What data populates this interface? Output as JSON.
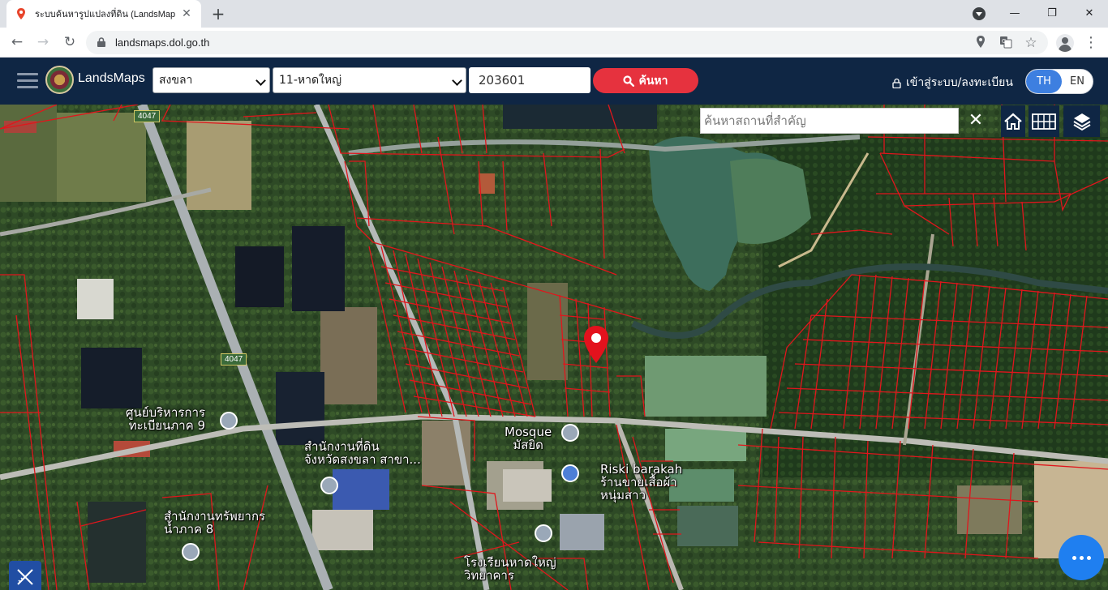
{
  "browser": {
    "tab_title": "ระบบค้นหารูปแปลงที่ดิน (LandsMaps",
    "url": "landsmaps.dol.go.th"
  },
  "header": {
    "brand": "LandsMaps",
    "province": "สงขลา",
    "district": "11-หาดใหญ่",
    "parcel_number": "203601",
    "search_label": "ค้นหา",
    "login_label": "เข้าสู่ระบบ/ลงทะเบียน",
    "lang_th": "TH",
    "lang_en": "EN"
  },
  "map": {
    "place_search_placeholder": "ค้นหาสถานที่สำคัญ",
    "road_shields": [
      "4047",
      "4047"
    ],
    "labels": {
      "office_region9_line1": "ศูนย์บริหารการ",
      "office_region9_line2": "ทะเบียนภาค 9",
      "land_office_line1": "สำนักงานที่ดิน",
      "land_office_line2": "จังหวัดสงขลา สาขา...",
      "resources_office_line1": "สำนักงานทรัพยากร",
      "resources_office_line2": "น้ำภาค 8",
      "mosque_en": "Mosque",
      "mosque_th": "มัสยิด",
      "shop_en": "Riski barakah",
      "shop_th_line1": "ร้านขายเสื้อผ้า",
      "shop_th_line2": "หนุ่มสาว",
      "school_line1": "โรงเรียนหาดใหญ่",
      "school_line2": "วิทยาคาร"
    }
  },
  "colors": {
    "header_bg": "#0f2644",
    "search_button": "#e6323e",
    "parcel_lines": "#e0161c",
    "lang_active": "#3d7fe0",
    "fab": "#1f7ff0"
  },
  "icons": [
    "map-pin-icon",
    "home-icon",
    "grid-icon",
    "layers-icon",
    "ruler-tool-icon",
    "more-icon",
    "search-icon",
    "lock-icon"
  ]
}
